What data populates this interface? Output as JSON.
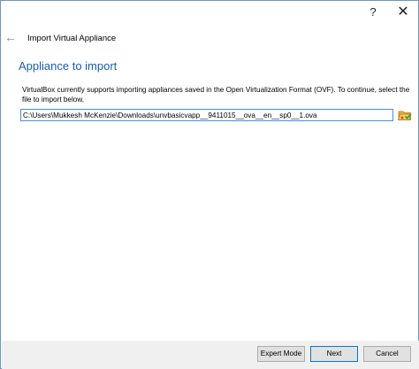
{
  "titlebar": {
    "help_label": "?",
    "close_label": "✕"
  },
  "wizard": {
    "title": "Import Virtual Appliance",
    "heading": "Appliance to import",
    "description": "VirtualBox currently supports importing appliances saved in the Open Virtualization Format (OVF). To continue, select the file to import below.",
    "file_path": "C:\\Users\\Mukkesh McKenzie\\Downloads\\unvbasicvapp__9411015__ova__en__sp0__1.ova"
  },
  "buttons": {
    "expert": "Expert Mode",
    "next": "Next",
    "cancel": "Cancel"
  },
  "icons": {
    "back": "back-arrow-icon",
    "folder": "folder-open-icon"
  },
  "colors": {
    "heading": "#1a5db5",
    "accent_border": "#4c8dd9",
    "footer_bg": "#f0f0f0"
  }
}
